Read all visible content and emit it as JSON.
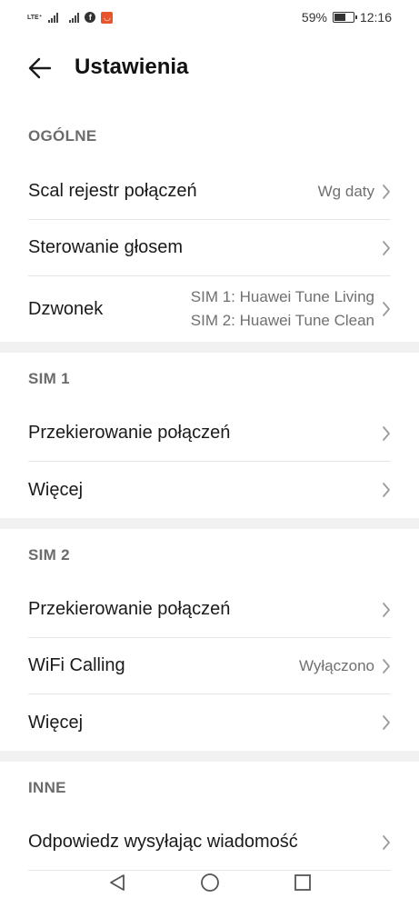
{
  "status_bar": {
    "network_label": "LTE⁺",
    "battery_percent": "59%",
    "battery_level": 0.59,
    "time": "12:16",
    "icons": [
      "signal-icon",
      "signal-icon",
      "facebook-icon",
      "aliexpress-icon",
      "battery-icon"
    ]
  },
  "header": {
    "title": "Ustawienia",
    "back_icon": "arrow-left-icon"
  },
  "sections": {
    "general": {
      "title": "OGÓLNE",
      "merge_log": {
        "label": "Scal rejestr połączeń",
        "value": "Wg daty"
      },
      "voice_control": {
        "label": "Sterowanie głosem"
      },
      "ringtone": {
        "label": "Dzwonek",
        "value_sim1": "SIM 1: Huawei Tune Living",
        "value_sim2": "SIM 2: Huawei Tune Clean"
      }
    },
    "sim1": {
      "title": "SIM 1",
      "forwarding": {
        "label": "Przekierowanie połączeń"
      },
      "more": {
        "label": "Więcej"
      }
    },
    "sim2": {
      "title": "SIM 2",
      "forwarding": {
        "label": "Przekierowanie połączeń"
      },
      "wifi_calling": {
        "label": "WiFi Calling",
        "value": "Wyłączono"
      },
      "more": {
        "label": "Więcej"
      }
    },
    "other": {
      "title": "INNE",
      "reply_message": {
        "label": "Odpowiedz wysyłając wiadomość"
      }
    }
  },
  "nav_bar": {
    "icons": [
      "back-triangle-icon",
      "home-circle-icon",
      "recents-square-icon"
    ]
  },
  "colors": {
    "text_primary": "#1a1a1a",
    "text_secondary": "#707070",
    "section_header": "#6b6b6b",
    "divider_band": "#f1f1f1"
  }
}
